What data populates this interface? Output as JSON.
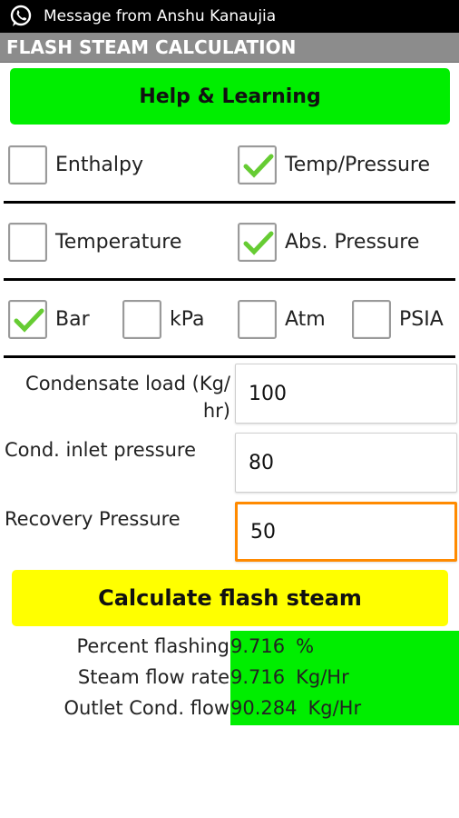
{
  "status_bar": {
    "notification": "Message from Anshu Kanaujia",
    "app_icon": "whatsapp-icon"
  },
  "app": {
    "title": "FLASH STEAM CALCULATION"
  },
  "help_button": {
    "label": "Help & Learning",
    "color": "#00ee00"
  },
  "mode_row": [
    {
      "label": "Enthalpy",
      "checked": false
    },
    {
      "label": "Temp/Pressure",
      "checked": true
    }
  ],
  "param_row": [
    {
      "label": "Temperature",
      "checked": false
    },
    {
      "label": "Abs. Pressure",
      "checked": true
    }
  ],
  "unit_row": [
    {
      "label": "Bar",
      "checked": true
    },
    {
      "label": "kPa",
      "checked": false
    },
    {
      "label": "Atm",
      "checked": false
    },
    {
      "label": "PSIA",
      "checked": false
    }
  ],
  "fields": {
    "condensate_load": {
      "label_line1": "Condensate load (Kg/",
      "label_line2": "hr)",
      "value": "100"
    },
    "inlet_pressure": {
      "label": "Cond. inlet pressure",
      "value": "80"
    },
    "recovery_pressure": {
      "label": "Recovery Pressure",
      "value": "50",
      "focused": true
    }
  },
  "calc_button": {
    "label": "Calculate flash steam",
    "color": "#ffff00"
  },
  "results": [
    {
      "label": "Percent flashing",
      "value": "9.716",
      "unit": "%"
    },
    {
      "label": "Steam flow rate",
      "value": "9.716",
      "unit": "Kg/Hr"
    },
    {
      "label": "Outlet Cond. flow",
      "value": "90.284",
      "unit": "Kg/Hr"
    }
  ]
}
